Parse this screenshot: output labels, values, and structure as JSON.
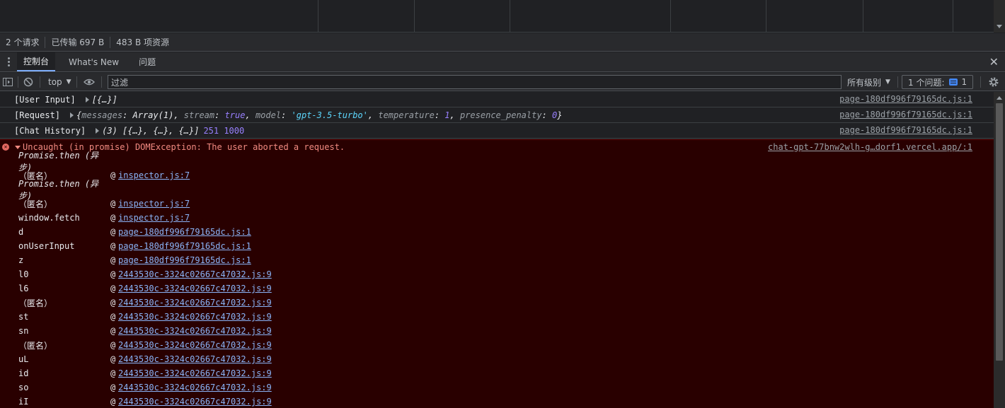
{
  "summary": {
    "requests": "2 个请求",
    "transferred": "已传输 697 B",
    "resources": "483 B 项资源"
  },
  "drawer": {
    "tabs": [
      {
        "label": "控制台"
      },
      {
        "label": "What's New"
      },
      {
        "label": "问题"
      }
    ],
    "close": "✕"
  },
  "toolbar": {
    "context": "top",
    "filter_placeholder": "过滤",
    "levels": "所有级别",
    "issues_label": "1 个问题:",
    "issues_count": "1"
  },
  "console": {
    "rows": [
      {
        "label": "[User Input]",
        "value": "[{…}]",
        "source": "page-180df996f79165dc.js:1"
      },
      {
        "label": "[Request]",
        "source": "page-180df996f79165dc.js:1",
        "object": {
          "messages": "Array(1)",
          "stream": "true",
          "model": "'gpt-3.5-turbo'",
          "temperature": "1",
          "presence_penalty": "0"
        }
      },
      {
        "label": "[Chat History]",
        "value": "(3) [{…}, {…}, {…}]",
        "extra": "251 1000",
        "source": "page-180df996f79165dc.js:1"
      }
    ],
    "error": {
      "message": "Uncaught (in promise) DOMException: The user aborted a request.",
      "source": "chat-gpt-77bnw2wlh-g…dorf1.vercel.app/:1",
      "frames": [
        {
          "fn": "Promise.then (异步)",
          "async": true
        },
        {
          "fn": "（匿名）",
          "link": "inspector.js:7"
        },
        {
          "fn": "Promise.then (异步)",
          "async": true
        },
        {
          "fn": "（匿名）",
          "link": "inspector.js:7"
        },
        {
          "fn": "window.fetch",
          "link": "inspector.js:7"
        },
        {
          "fn": "d",
          "link": "page-180df996f79165dc.js:1"
        },
        {
          "fn": "onUserInput",
          "link": "page-180df996f79165dc.js:1"
        },
        {
          "fn": "z",
          "link": "page-180df996f79165dc.js:1"
        },
        {
          "fn": "l0",
          "link": "2443530c-3324c02667c47032.js:9"
        },
        {
          "fn": "l6",
          "link": "2443530c-3324c02667c47032.js:9"
        },
        {
          "fn": "（匿名）",
          "link": "2443530c-3324c02667c47032.js:9"
        },
        {
          "fn": "st",
          "link": "2443530c-3324c02667c47032.js:9"
        },
        {
          "fn": "sn",
          "link": "2443530c-3324c02667c47032.js:9"
        },
        {
          "fn": "（匿名）",
          "link": "2443530c-3324c02667c47032.js:9"
        },
        {
          "fn": "uL",
          "link": "2443530c-3324c02667c47032.js:9"
        },
        {
          "fn": "id",
          "link": "2443530c-3324c02667c47032.js:9"
        },
        {
          "fn": "so",
          "link": "2443530c-3324c02667c47032.js:9"
        },
        {
          "fn": "iI",
          "link": "2443530c-3324c02667c47032.js:9"
        }
      ]
    }
  }
}
